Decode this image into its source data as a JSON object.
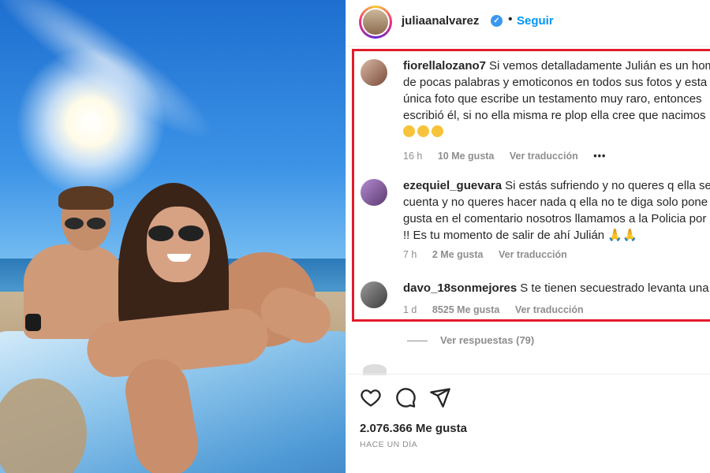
{
  "post": {
    "username": "juliaanalvarez",
    "follow_label": "Seguir",
    "separator": "•"
  },
  "comments": [
    {
      "user": "fiorellalozano7",
      "lines": [
        "Si vemos detalladamente Julián es un hom",
        "de pocas palabras y emoticonos en todos sus fotos y esta",
        "única foto que escribe un testamento muy raro, entonces",
        "escribió él, si no ella misma re plop ella cree que nacimos"
      ],
      "emojis": [
        "😂",
        "😂",
        "😂"
      ],
      "time": "16 h",
      "likes": "10 Me gusta",
      "translate": "Ver traducción",
      "more": "•••"
    },
    {
      "user": "ezequiel_guevara",
      "lines": [
        "Si estás sufriendo y no queres q ella se",
        "cuenta y no queres hacer nada q ella no te diga solo pone",
        "gusta en el comentario nosotros llamamos a la Policia por",
        "!! Es tu momento de salir de ahí Julián 🙏🙏"
      ],
      "time": "7 h",
      "likes": "2 Me gusta",
      "translate": "Ver traducción"
    },
    {
      "user": "davo_18sonmejores",
      "lines": [
        "S te tienen secuestrado levanta una c"
      ],
      "time": "1 d",
      "likes": "8525 Me gusta",
      "translate": "Ver traducción"
    }
  ],
  "view_replies": "Ver respuestas (79)",
  "likes_total": "2.076.366 Me gusta",
  "time_ago": "HACE UN DÍA",
  "icons": [
    "heart-icon",
    "comment-icon",
    "share-icon"
  ],
  "colors": {
    "follow": "#0095f6",
    "highlight_border": "#e11c2a",
    "verified": "#3897f0"
  }
}
